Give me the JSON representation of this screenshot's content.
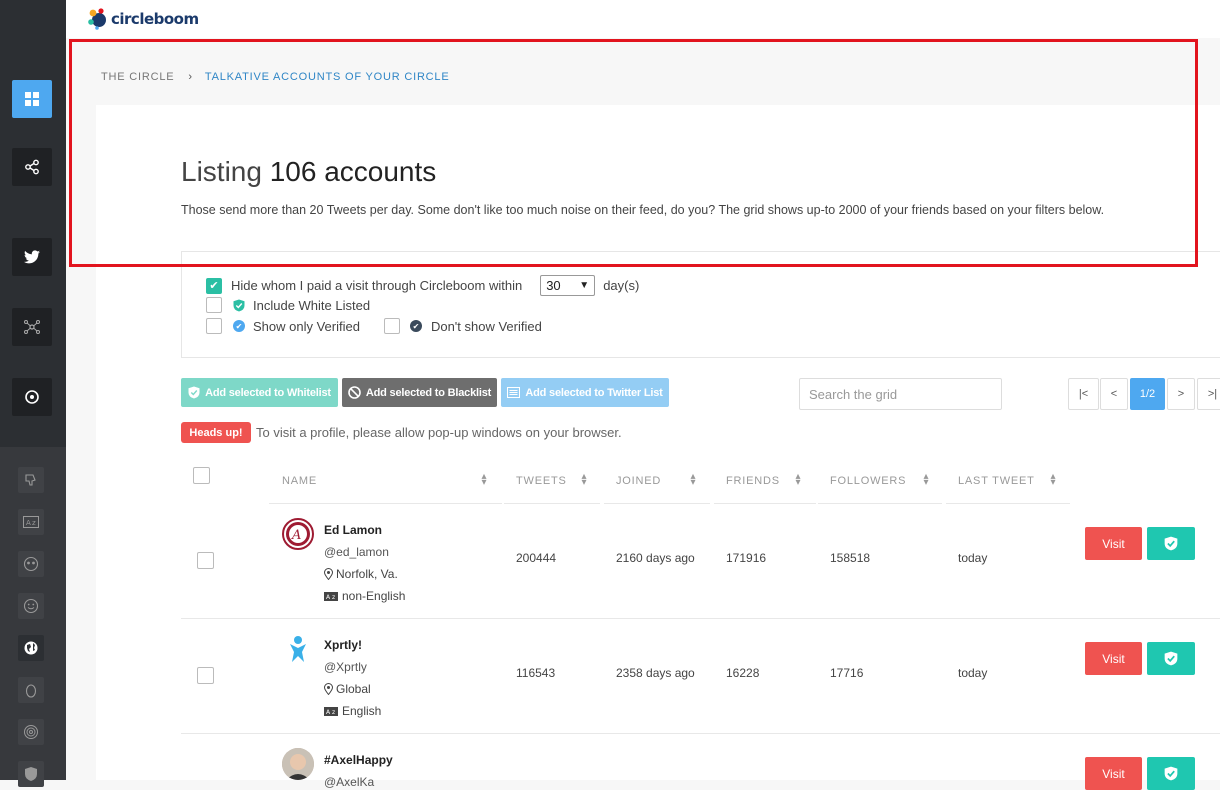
{
  "app": {
    "logo_text": "circleboom"
  },
  "breadcrumb": {
    "root": "THE CIRCLE",
    "separator": "›",
    "current": "TALKATIVE ACCOUNTS OF YOUR CIRCLE"
  },
  "page": {
    "title_prefix": "Listing ",
    "title_count": "106 accounts",
    "subtitle": "Those send more than 20 Tweets per day. Some don't like too much noise on their feed, do you? The grid shows up-to 2000 of your friends based on your filters below."
  },
  "filters": {
    "hide_visited_label": "Hide whom I paid a visit through Circleboom within",
    "hide_visited_checked": true,
    "days_value": "30",
    "days_suffix": "day(s)",
    "include_whitelisted_label": "Include White Listed",
    "only_verified_label": "Show only Verified",
    "dont_show_verified_label": "Don't show Verified"
  },
  "actions": {
    "whitelist_label": "Add selected to Whitelist",
    "blacklist_label": "Add selected to Blacklist",
    "twitter_list_label": "Add selected to Twitter List",
    "search_placeholder": "Search the grid"
  },
  "pagination": {
    "first": "|<",
    "prev": "<",
    "current": "1/2",
    "next": ">",
    "last": ">|"
  },
  "notice": {
    "badge": "Heads up!",
    "text": "To visit a profile, please allow pop-up windows on your browser."
  },
  "table": {
    "headers": {
      "name": "NAME",
      "tweets": "TWEETS",
      "joined": "JOINED",
      "friends": "FRIENDS",
      "followers": "FOLLOWERS",
      "last_tweet": "LAST TWEET"
    },
    "visit_label": "Visit",
    "rows": [
      {
        "name": "Ed Lamon",
        "handle": "@ed_lamon",
        "location": "Norfolk, Va.",
        "language": "non-English",
        "tweets": "200444",
        "joined": "2160 days ago",
        "friends": "171916",
        "followers": "158518",
        "last_tweet": "today"
      },
      {
        "name": "Xprtly!",
        "handle": "@Xprtly",
        "location": "Global",
        "language": "English",
        "tweets": "116543",
        "joined": "2358 days ago",
        "friends": "16228",
        "followers": "17716",
        "last_tweet": "today"
      },
      {
        "name": "#AxelHappy",
        "handle": "@AxelKa",
        "location": "",
        "language": "",
        "tweets": "",
        "joined": "",
        "friends": "",
        "followers": "",
        "last_tweet": ""
      }
    ]
  },
  "colors": {
    "accent_blue": "#4ea8f0",
    "danger_red": "#ef5350",
    "teal": "#1fc7b0",
    "highlight_red": "#e2141e"
  },
  "icons": [
    "dashboard-icon",
    "share-icon",
    "twitter-icon",
    "network-icon",
    "target-icon",
    "thumbs-down-icon",
    "language-icon",
    "eyes-icon",
    "smile-icon",
    "globe-icon",
    "egg-icon",
    "spiral-icon",
    "shield-icon"
  ]
}
